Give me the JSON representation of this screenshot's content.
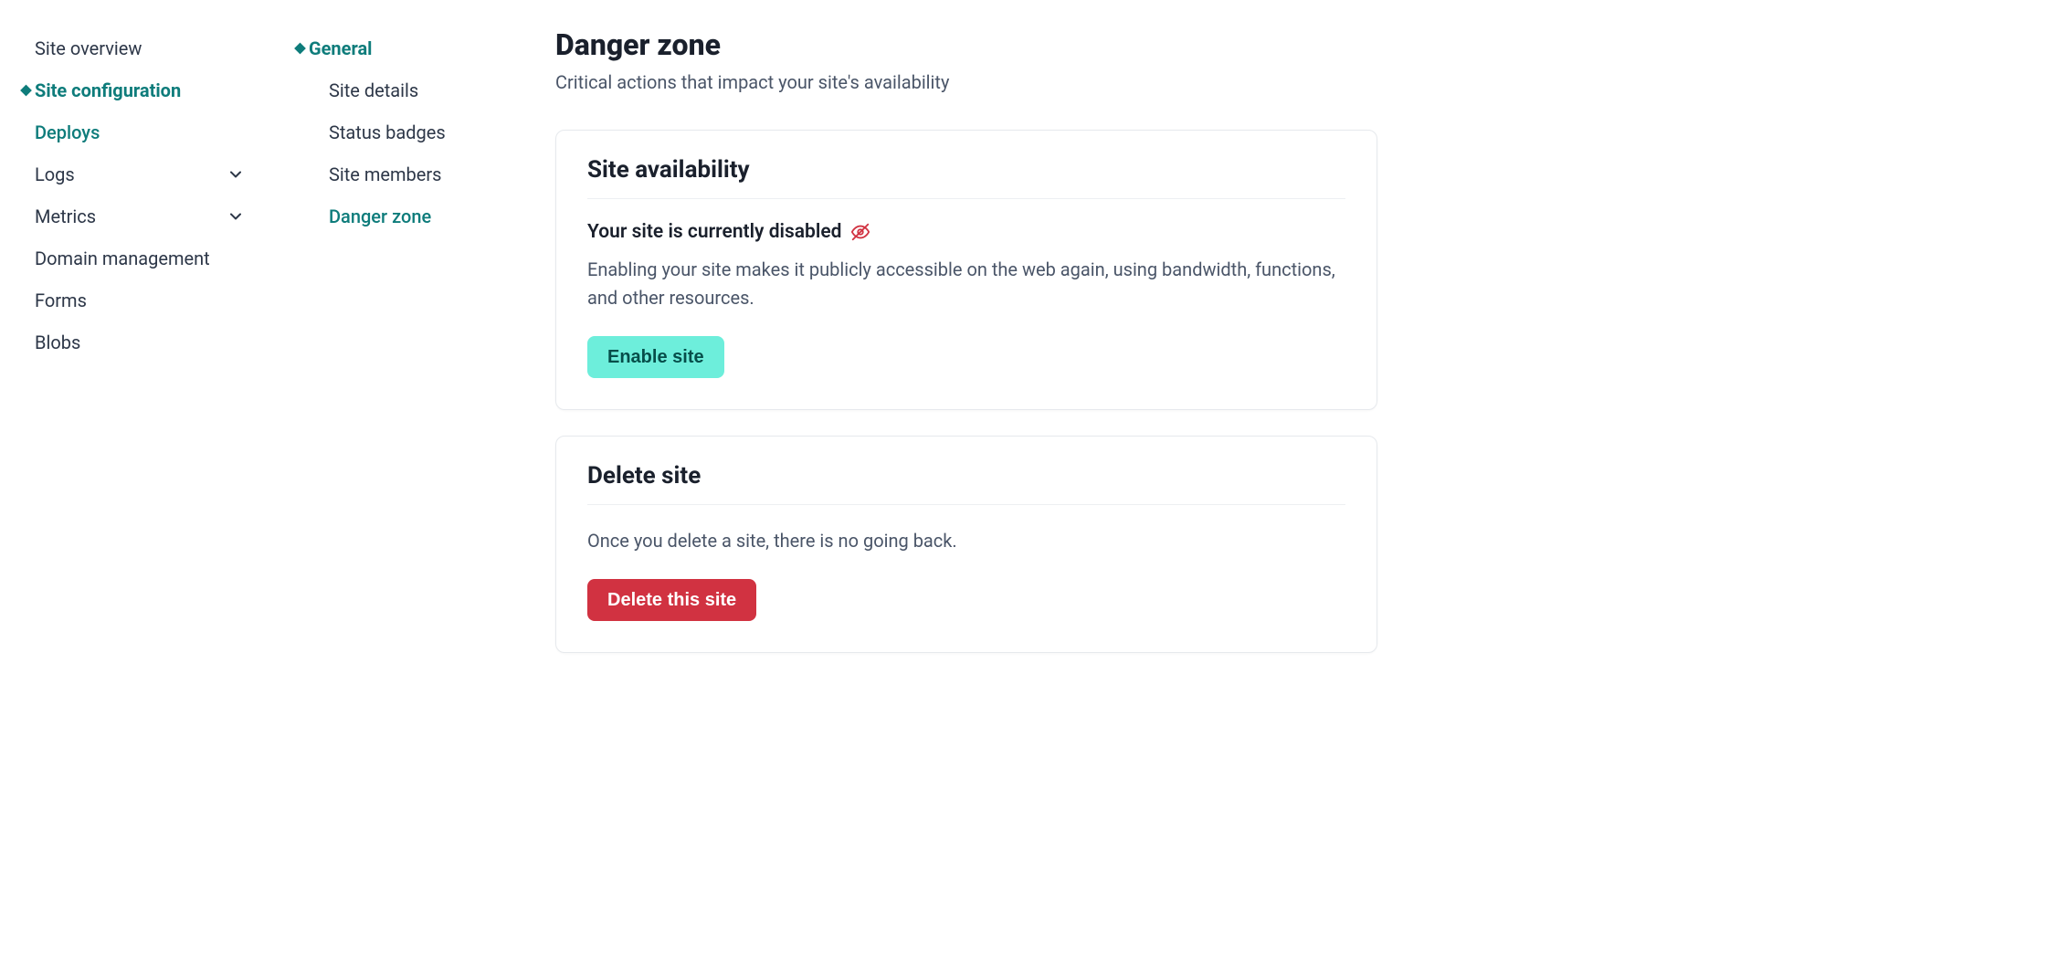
{
  "sidebar": {
    "items": [
      {
        "label": "Site overview",
        "active": false,
        "teal": false,
        "diamond": false,
        "chevron": false
      },
      {
        "label": "Site configuration",
        "active": true,
        "teal": true,
        "diamond": true,
        "chevron": false
      },
      {
        "label": "Deploys",
        "active": false,
        "teal": true,
        "diamond": false,
        "chevron": false
      },
      {
        "label": "Logs",
        "active": false,
        "teal": false,
        "diamond": false,
        "chevron": true
      },
      {
        "label": "Metrics",
        "active": false,
        "teal": false,
        "diamond": false,
        "chevron": true
      },
      {
        "label": "Domain management",
        "active": false,
        "teal": false,
        "diamond": false,
        "chevron": false
      },
      {
        "label": "Forms",
        "active": false,
        "teal": false,
        "diamond": false,
        "chevron": false
      },
      {
        "label": "Blobs",
        "active": false,
        "teal": false,
        "diamond": false,
        "chevron": false
      }
    ]
  },
  "subnav": {
    "items": [
      {
        "label": "General",
        "active": true,
        "teal": true,
        "diamond": true
      },
      {
        "label": "Site details",
        "active": false,
        "teal": false,
        "diamond": false
      },
      {
        "label": "Status badges",
        "active": false,
        "teal": false,
        "diamond": false
      },
      {
        "label": "Site members",
        "active": false,
        "teal": false,
        "diamond": false
      },
      {
        "label": "Danger zone",
        "active": false,
        "teal": true,
        "diamond": false
      }
    ]
  },
  "main": {
    "title": "Danger zone",
    "subtitle": "Critical actions that impact your site's availability",
    "availability": {
      "card_title": "Site availability",
      "status": "Your site is currently disabled",
      "description": "Enabling your site makes it publicly accessible on the web again, using bandwidth, functions, and other resources.",
      "button": "Enable site"
    },
    "delete": {
      "card_title": "Delete site",
      "description": "Once you delete a site, there is no going back.",
      "button": "Delete this site"
    }
  },
  "colors": {
    "teal": "#0e7c7b",
    "teal_button": "#6deedb",
    "red_button": "#d13241",
    "icon_red": "#d13241"
  }
}
